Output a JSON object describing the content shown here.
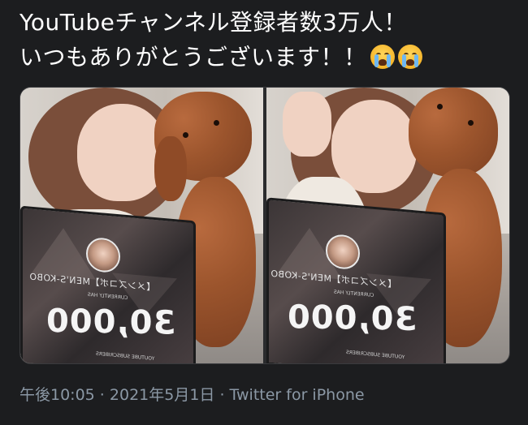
{
  "tweet": {
    "line1": "YouTubeチャンネル登録者数3万人！",
    "line2": "いつもありがとうございます！！",
    "emoji": [
      "crying-face",
      "crying-face"
    ]
  },
  "media": {
    "photos": [
      {
        "screen_title": "【メンズコボ】MEN'S-KOBO",
        "screen_sub": "CURRENTLY HAS",
        "screen_count": "30,000",
        "screen_footer": "YOUTUBE SUBSCRIBERS"
      },
      {
        "screen_title": "【メンズコボ】MEN'S-KOBO",
        "screen_sub": "CURRENTLY HAS",
        "screen_count": "30,000",
        "screen_footer": "YOUTUBE SUBSCRIBERS"
      }
    ]
  },
  "meta": {
    "time": "午後10:05",
    "sep1": " · ",
    "date": "2021年5月1日",
    "sep2": " · ",
    "source": "Twitter for iPhone"
  },
  "colors": {
    "background": "#1c1d1f",
    "text": "#ffffff",
    "meta": "#8b98a5"
  }
}
